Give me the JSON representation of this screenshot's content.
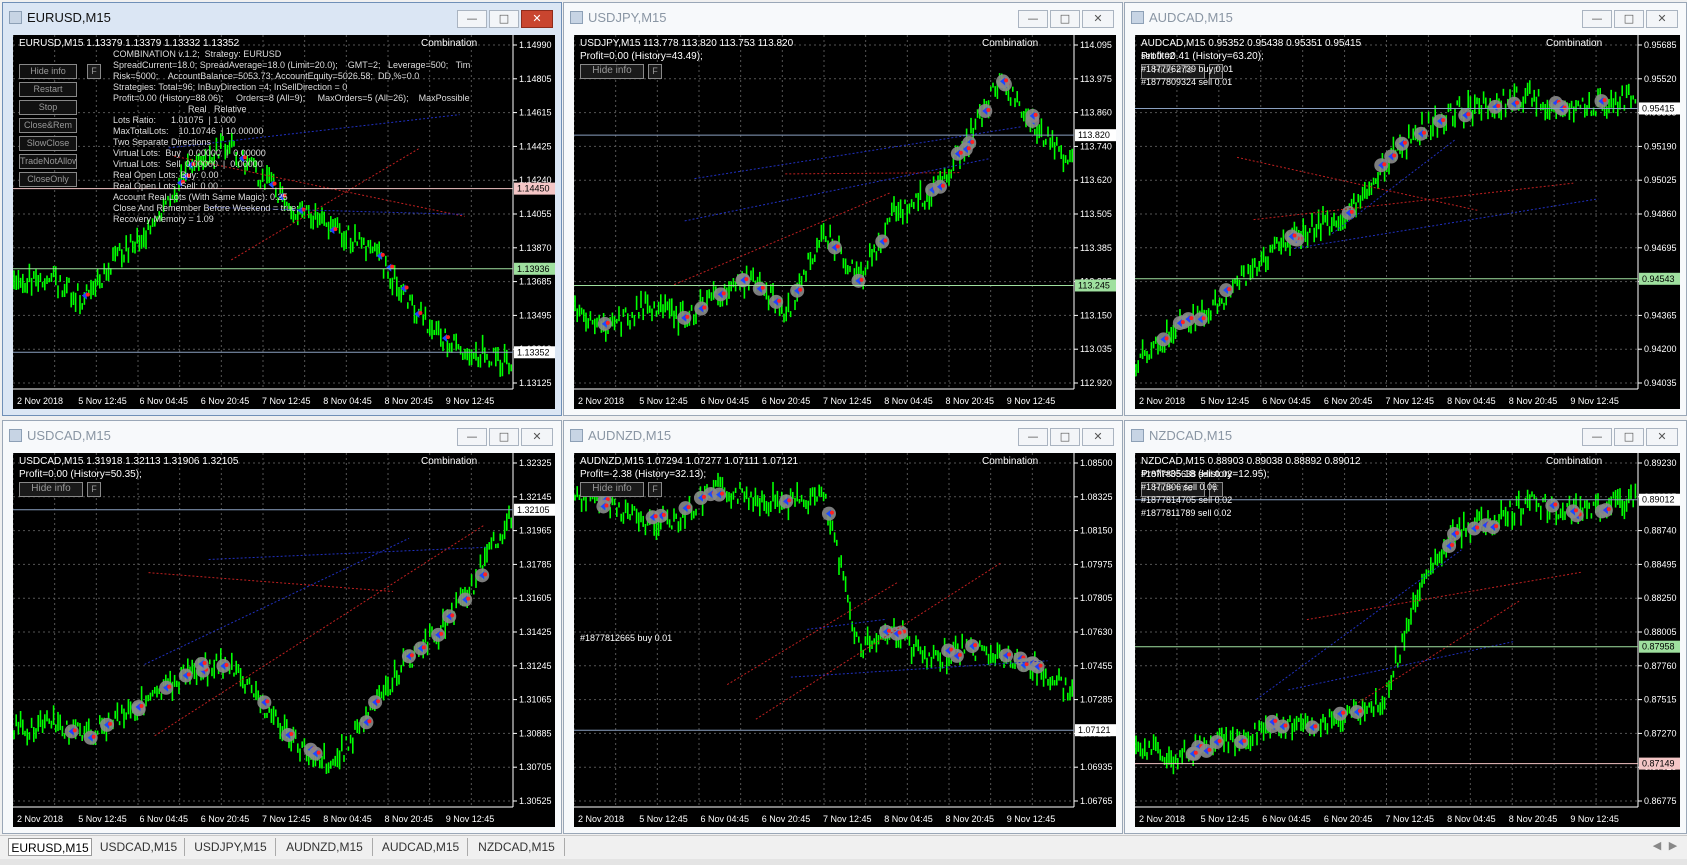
{
  "windows": [
    {
      "title": "EURUSD,M15",
      "active": true,
      "sym": "EURUSD,M15  1.13379 1.13379 1.13332 1.13352",
      "ea": "Combination",
      "prices": [
        "1.14990",
        "1.14805",
        "1.14615",
        "1.14425",
        "1.14240",
        "1.14055",
        "1.13870",
        "1.13685",
        "1.13495",
        "1.13310",
        "1.13125"
      ],
      "dates": [
        "2 Nov 2018",
        "5 Nov 12:45",
        "6 Nov 04:45",
        "6 Nov 20:45",
        "7 Nov 12:45",
        "8 Nov 04:45",
        "8 Nov 20:45",
        "9 Nov 12:45"
      ],
      "tags": [
        {
          "text": "1.14450",
          "color": "#f4c6c6",
          "pos": 0.43
        },
        {
          "text": "1.13936",
          "color": "#9fe09f",
          "pos": 0.67
        },
        {
          "text": "1.13352",
          "color": "#ffffff",
          "pos": 0.92
        }
      ],
      "buttons": [
        "Hide info",
        "Restart",
        "Stop",
        "Close&Rem",
        "SlowClose",
        "TradeNotAllow",
        "CloseOnly"
      ],
      "info": [
        "COMBINATION v.1.2;  Strategy: EURUSD",
        "SpreadCurrent=18.0; SpreadAverage=18.0 (Limit=20.0);    GMT=2;   Leverage=500;   Tim",
        "Risk=5000;    AccountBalance=5053.73; AccountEquity=5026.58;  DD,%=0.0",
        "Strategies: Total=96; InBuyDirection =4; InSellDirection = 0",
        "Profit=0.00 (History=88.06);     Orders=8 (All=9);     MaxOrders=5 (All=26);    MaxPossible",
        "                              Real   Relative",
        "Lots Ratio:      1.01075  | 1.000",
        "MaxTotalLots:    10.10746  | 10.00000",
        "",
        "Two Separate Directions",
        "Virtual Lots:  Buy   0.00000  |  0.00000",
        "Virtual Lots:  Sell  0.00000  |  0.00000",
        "Real Open Lots: Buy: 0.00",
        "Real Open Lots: Sell: 0.00",
        "Account Real Lots (With Same Magic): 0.25",
        "Close And Remember Before Weekend = true;",
        "",
        "Recovery Memory = 1.09"
      ],
      "trend": 0,
      "orders": []
    },
    {
      "title": "USDJPY,M15",
      "active": false,
      "sym": "USDJPY,M15  113.778 113.820 113.753 113.820",
      "profit": "Profit=0.00 (History=43.49);",
      "ea": "Combination",
      "prices": [
        "114.095",
        "113.975",
        "113.860",
        "113.740",
        "113.620",
        "113.505",
        "113.385",
        "113.265",
        "113.150",
        "113.035",
        "112.920"
      ],
      "dates": [
        "2 Nov 2018",
        "5 Nov 12:45",
        "6 Nov 04:45",
        "6 Nov 20:45",
        "7 Nov 12:45",
        "8 Nov 04:45",
        "8 Nov 20:45",
        "9 Nov 12:45"
      ],
      "tags": [
        {
          "text": "113.820",
          "color": "#ffffff",
          "pos": 0.27
        },
        {
          "text": "113.245",
          "color": "#9fe09f",
          "pos": 0.72
        }
      ],
      "buttons": [
        "Hide info"
      ],
      "trend": 1,
      "orders": []
    },
    {
      "title": "AUDCAD,M15",
      "active": false,
      "sym": "AUDCAD,M15  0.95352 0.95438 0.95351 0.95415",
      "profit": "Profit=0.41 (History=63.20);",
      "ea": "Combination",
      "prices": [
        "0.95685",
        "0.95520",
        "0.95355",
        "0.95190",
        "0.95025",
        "0.94860",
        "0.94695",
        "0.94530",
        "0.94365",
        "0.94200",
        "0.94035"
      ],
      "dates": [
        "2 Nov 2018",
        "5 Nov 12:45",
        "6 Nov 04:45",
        "6 Nov 20:45",
        "7 Nov 12:45",
        "8 Nov 04:45",
        "8 Nov 20:45",
        "9 Nov 12:45"
      ],
      "tags": [
        {
          "text": "0.95415",
          "color": "#ffffff",
          "pos": 0.19
        },
        {
          "text": "0.94543",
          "color": "#9fe09f",
          "pos": 0.7
        }
      ],
      "buttons": [
        "Hide info"
      ],
      "trend": 2,
      "orders": [
        "sell 0.02",
        "#1877762739 buy 0.01",
        "#1877809324 sell 0.01"
      ]
    },
    {
      "title": "USDCAD,M15",
      "active": false,
      "sym": "USDCAD,M15  1.31918 1.32113 1.31906 1.32105",
      "profit": "Profit=0.00 (History=50.35);",
      "ea": "Combination",
      "prices": [
        "1.32325",
        "1.32145",
        "1.31965",
        "1.31785",
        "1.31605",
        "1.31425",
        "1.31245",
        "1.31065",
        "1.30885",
        "1.30705",
        "1.30525"
      ],
      "dates": [
        "2 Nov 2018",
        "5 Nov 12:45",
        "6 Nov 04:45",
        "6 Nov 20:45",
        "7 Nov 12:45",
        "8 Nov 04:45",
        "8 Nov 20:45",
        "9 Nov 12:45"
      ],
      "tags": [
        {
          "text": "1.32105",
          "color": "#ffffff",
          "pos": 0.14
        }
      ],
      "buttons": [
        "Hide info"
      ],
      "trend": 3,
      "orders": []
    },
    {
      "title": "AUDNZD,M15",
      "active": false,
      "sym": "AUDNZD,M15  1.07294 1.07277 1.07111 1.07121",
      "profit": "Profit=-2.38 (History=32.13);",
      "ea": "Combination",
      "prices": [
        "1.08500",
        "1.08325",
        "1.08150",
        "1.07975",
        "1.07805",
        "1.07630",
        "1.07455",
        "1.07285",
        "1.07110",
        "1.06935",
        "1.06765"
      ],
      "dates": [
        "2 Nov 2018",
        "5 Nov 12:45",
        "6 Nov 04:45",
        "6 Nov 20:45",
        "7 Nov 12:45",
        "8 Nov 04:45",
        "8 Nov 20:45",
        "9 Nov 12:45"
      ],
      "tags": [
        {
          "text": "1.07121",
          "color": "#ffffff",
          "pos": 0.8
        }
      ],
      "buttons": [
        "Hide info"
      ],
      "trend": 4,
      "orders": [
        "#1877812665 buy 0.01"
      ]
    },
    {
      "title": "NZDCAD,M15",
      "active": false,
      "sym": "NZDCAD,M15  0.88903 0.89038 0.88892 0.89012",
      "profit": "Profit=35.18 (History=12.95);",
      "ea": "Combination",
      "prices": [
        "0.89230",
        "0.88985",
        "0.88740",
        "0.88495",
        "0.88250",
        "0.88005",
        "0.87760",
        "0.87515",
        "0.87270",
        "0.87025",
        "0.86775"
      ],
      "dates": [
        "2 Nov 2018",
        "5 Nov 12:45",
        "6 Nov 04:45",
        "6 Nov 20:45",
        "7 Nov 12:45",
        "8 Nov 04:45",
        "8 Nov 20:45",
        "9 Nov 12:45"
      ],
      "tags": [
        {
          "text": "0.89012",
          "color": "#ffffff",
          "pos": 0.11
        },
        {
          "text": "0.87958",
          "color": "#9fe09f",
          "pos": 0.55
        },
        {
          "text": "0.87149",
          "color": "#f4c6c6",
          "pos": 0.9
        }
      ],
      "buttons": [
        "Hide info"
      ],
      "trend": 5,
      "orders": [
        "#1877805638 sell 0.02",
        "#1877806 sell 0.06",
        "#1877814705 sell 0.02",
        "#1877811789 sell 0.02"
      ]
    }
  ],
  "tabs": [
    "EURUSD,M15",
    "USDCAD,M15",
    "USDJPY,M15",
    "AUDNZD,M15",
    "AUDCAD,M15",
    "NZDCAD,M15"
  ],
  "colors": {
    "candle": "#00ff00",
    "grid": "#555555",
    "axis": "#ffffff",
    "buy": "#ff2020",
    "sell": "#2040ff"
  }
}
